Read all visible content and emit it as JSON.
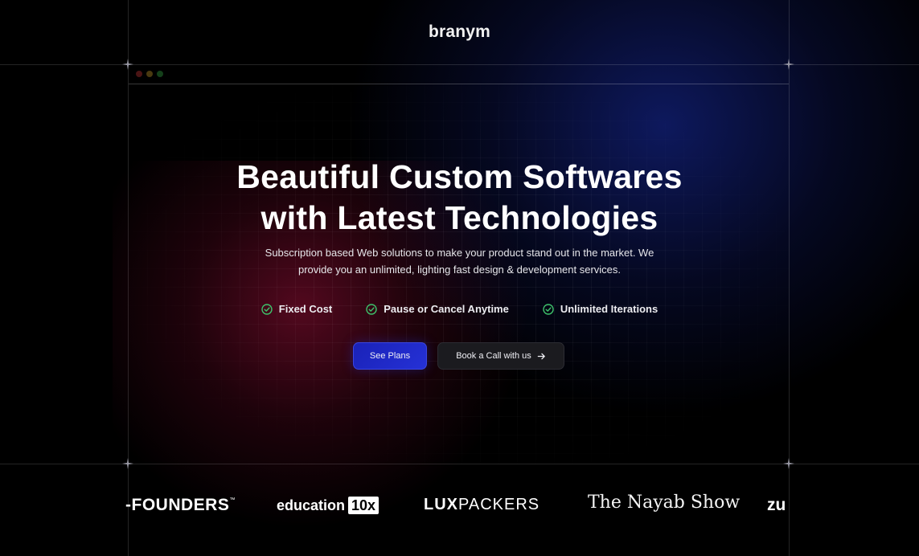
{
  "brand": {
    "name": "branym"
  },
  "window": {
    "dot_colors": [
      "#4a1414",
      "#4a3a10",
      "#14401a"
    ]
  },
  "hero": {
    "title_line1": "Beautiful Custom Softwares",
    "title_line2": "with Latest Technologies",
    "subtitle_line1": "Subscription based Web solutions to make your product stand out in the market. We",
    "subtitle_line2": "provide you an unlimited, lighting fast design & development services."
  },
  "features": [
    {
      "label": "Fixed Cost",
      "icon": "check-circle-icon"
    },
    {
      "label": "Pause or Cancel Anytime",
      "icon": "check-circle-icon"
    },
    {
      "label": "Unlimited Iterations",
      "icon": "check-circle-icon"
    }
  ],
  "cta": {
    "primary_label": "See Plans",
    "secondary_label": "Book a Call with us",
    "secondary_icon": "arrow-right-icon"
  },
  "logos": {
    "founders": "-FOUNDERS",
    "founders_tm": "™",
    "education": "education",
    "education_badge": "10x",
    "lux_bold": "LUX",
    "lux_rest": "PACKERS",
    "nayab": "The Nayab Show",
    "zu": "zu"
  },
  "colors": {
    "accent_blue": "#2531d6",
    "check_green": "#3ec26b",
    "background": "#000000"
  }
}
